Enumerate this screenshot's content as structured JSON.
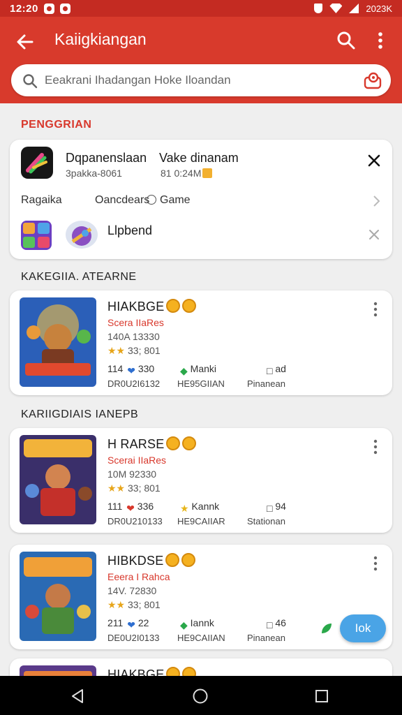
{
  "status_bar": {
    "time": "12:20",
    "right_text": "2023K"
  },
  "header": {
    "title": "Kaiigkiangan"
  },
  "search": {
    "placeholder": "Eeakrani Ihadangan Hoke Iloandan"
  },
  "recommend": {
    "section_title": "PENGGRIAN",
    "app_name": "Dqpanenslaan",
    "app_name2": "Vake dinanam",
    "sub1": "3pakka-8061",
    "sub2": "81 0:24M",
    "filters": [
      "Ragaika",
      "Oancdears",
      "Game"
    ],
    "second_name": "Llpbend"
  },
  "sections": {
    "label1": "KAKEGIIA. ATEARNE",
    "label2": "KARIIGDIAIS IANEPB"
  },
  "games": [
    {
      "title": "HIAKBGE",
      "developer": "Scera IIaRes",
      "meta": "140A 13330",
      "rating": "33; 801",
      "s1": "114",
      "s1b": "330",
      "s2": "Manki",
      "s3": "ad",
      "l1": "DR0U2I6132",
      "l2": "HE95GIIAN",
      "l3": "Pinanean"
    },
    {
      "title": "H RARSE",
      "developer": "Scerai IIaRes",
      "meta": "10M 92330",
      "rating": "33; 801",
      "s1": "111",
      "s1b": "336",
      "s2": "Kannk",
      "s3": "94",
      "l1": "DR0U210133",
      "l2": "HE9CAIIAR",
      "l3": "Stationan"
    },
    {
      "title": "HIBKDSE",
      "developer": "Eeera I Rahca",
      "meta": "14V. 72830",
      "rating": "33; 801",
      "s1": "211",
      "s1b": "22",
      "s2": "Iannk",
      "s3": "46",
      "l1": "DE0U2I0133",
      "l2": "HE9CAIIAN",
      "l3": "Pinanean"
    },
    {
      "title": "HIAKBGE"
    }
  ],
  "fab_label": "Iok",
  "colors": {
    "primary": "#d83a2c",
    "status": "#c42b22",
    "fab": "#4aa4e6"
  }
}
